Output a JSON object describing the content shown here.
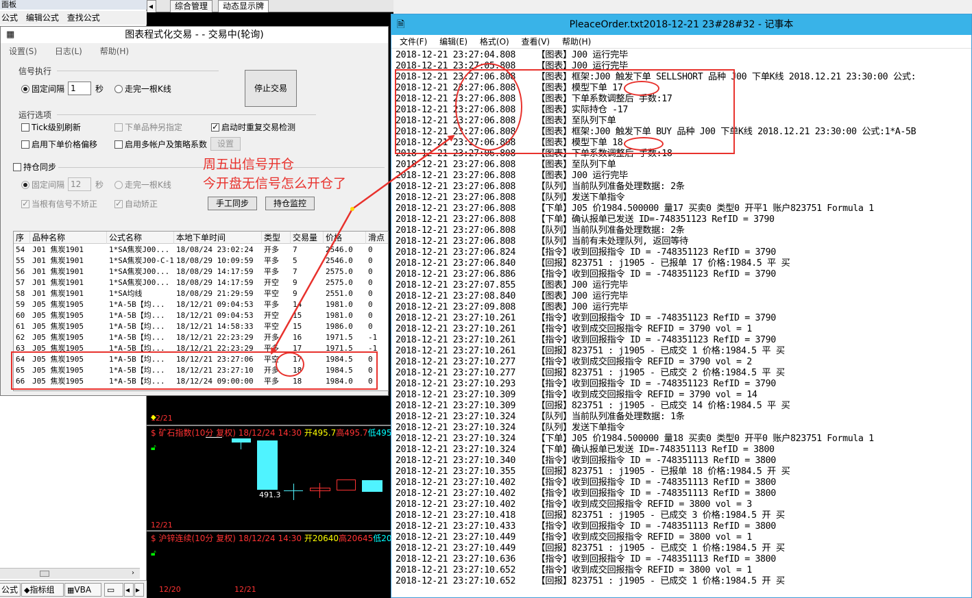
{
  "left_panel": {
    "title": "面板",
    "menu": [
      "公式",
      "编辑公式",
      "查找公式"
    ],
    "tabs": [
      "公式",
      "指标组",
      "VBA"
    ]
  },
  "chart": {
    "tabs": [
      "综合管理",
      "动态显示牌"
    ],
    "header1": {
      "icon": "$",
      "name": "矿石指数(10分 复权) 18/12/24 14:30",
      "open": "开495.7",
      "high": "高495.7",
      "low": "低495"
    },
    "price_label": "491.3",
    "date1": "12/21",
    "date_top": "12/21",
    "header2": {
      "icon": "$",
      "name": "沪锌连续(10分 复权) 18/12/24 14:30",
      "open": "开20640",
      "high": "高20645",
      "low": "低20"
    },
    "date2a": "12/20",
    "date2b": "12/21"
  },
  "dialog": {
    "title": "图表程式化交易 - - 交易中(轮询)",
    "menu": [
      "设置(S)",
      "日志(L)",
      "帮助(H)"
    ],
    "signal_group": "信号执行",
    "fixed_interval": "固定间隔",
    "interval_value": "1",
    "seconds": "秒",
    "walk_kline": "走完一根K线",
    "stop_button": "停止交易",
    "run_options": "运行选项",
    "tick_refresh": "Tick级别刷新",
    "other_symbol": "下单品种另指定",
    "restart_check": "启动时重复交易检测",
    "price_offset": "启用下单价格偏移",
    "multi_account": "启用多帐户及策略系数",
    "settings_button": "设置",
    "pos_sync": "持仓同步",
    "sync_interval": "固定间隔",
    "sync_value": "12",
    "sync_seconds": "秒",
    "sync_walk": "走完一根K线",
    "no_correct": "当根有信号不矫正",
    "auto_correct": "自动矫正",
    "manual_sync_button": "手工同步",
    "pos_monitor_button": "持仓监控",
    "table": {
      "headers": [
        "序",
        "品种名称",
        "公式名称",
        "本地下单时间",
        "类型",
        "交易量",
        "价格",
        "滑点"
      ],
      "rows": [
        [
          "54",
          "J01 焦炭1901",
          "1*SA焦炭J00...",
          "18/08/24 23:02:24",
          "开多",
          "7",
          "2546.0",
          "0"
        ],
        [
          "55",
          "J01 焦炭1901",
          "1*SA焦炭J00-C-1",
          "18/08/29 10:09:59",
          "平多",
          "5",
          "2546.0",
          "0"
        ],
        [
          "56",
          "J01 焦炭1901",
          "1*SA焦炭J00...",
          "18/08/29 14:17:59",
          "平多",
          "7",
          "2575.0",
          "0"
        ],
        [
          "57",
          "J01 焦炭1901",
          "1*SA焦炭J00...",
          "18/08/29 14:17:59",
          "开空",
          "9",
          "2575.0",
          "0"
        ],
        [
          "58",
          "J01 焦炭1901",
          "1*SA均线",
          "18/08/29 21:29:59",
          "平空",
          "9",
          "2551.0",
          "0"
        ],
        [
          "59",
          "J05 焦炭1905",
          "1*A-5B【均...",
          "18/12/21 09:04:53",
          "平多",
          "14",
          "1981.0",
          "0"
        ],
        [
          "60",
          "J05 焦炭1905",
          "1*A-5B【均...",
          "18/12/21 09:04:53",
          "开空",
          "15",
          "1981.0",
          "0"
        ],
        [
          "61",
          "J05 焦炭1905",
          "1*A-5B【均...",
          "18/12/21 14:58:33",
          "平空",
          "15",
          "1986.0",
          "0"
        ],
        [
          "62",
          "J05 焦炭1905",
          "1*A-5B【均...",
          "18/12/21 22:23:29",
          "开多",
          "16",
          "1971.5",
          "-1"
        ],
        [
          "63",
          "J05 焦炭1905",
          "1*A-5B【均...",
          "18/12/21 22:23:29",
          "平多",
          "17",
          "1971.5",
          "-1"
        ],
        [
          "64",
          "J05 焦炭1905",
          "1*A-5B【均...",
          "18/12/21 23:27:06",
          "平空",
          "17",
          "1984.5",
          "0"
        ],
        [
          "65",
          "J05 焦炭1905",
          "1*A-5B【均...",
          "18/12/21 23:27:10",
          "开多",
          "18",
          "1984.5",
          "0"
        ],
        [
          "66",
          "J05 焦炭1905",
          "1*A-5B【均...",
          "18/12/24 09:00:00",
          "平多",
          "18",
          "1984.0",
          "0"
        ]
      ]
    }
  },
  "annotation": {
    "line1": "周五出信号开仓",
    "line2": "今开盘无信号怎么开仓了"
  },
  "notepad": {
    "title": "PleaceOrder.txt2018-12-21 23#28#32 - 记事本",
    "menu": [
      "文件(F)",
      "编辑(E)",
      "格式(O)",
      "查看(V)",
      "帮助(H)"
    ],
    "lines": [
      "2018-12-21 23:27:04.808    【图表】J00 运行完毕",
      "2018-12-21 23:27:05.808    【图表】J00 运行完毕",
      "2018-12-21 23:27:06.808    【图表】框架:J00 触发下单 SELLSHORT 品种 J00 下单K线 2018.12.21 23:30:00 公式:",
      "2018-12-21 23:27:06.808    【图表】模型下单 17",
      "2018-12-21 23:27:06.808    【图表】下单系数调整后 手数:17",
      "2018-12-21 23:27:06.808    【图表】实际持仓 -17",
      "2018-12-21 23:27:06.808    【图表】至队列下单",
      "2018-12-21 23:27:06.808    【图表】框架:J00 触发下单 BUY 品种 J00 下单K线 2018.12.21 23:30:00 公式:1*A-5B",
      "2018-12-21 23:27:06.808    【图表】模型下单 18",
      "2018-12-21 23:27:06.808    【图表】下单系数调整后 手数:18",
      "2018-12-21 23:27:06.808    【图表】至队列下单",
      "2018-12-21 23:27:06.808    【图表】J00 运行完毕",
      "2018-12-21 23:27:06.808    【队列】当前队列准备处理数据: 2条",
      "2018-12-21 23:27:06.808    【队列】发送下单指令",
      "2018-12-21 23:27:06.808    【下单】J05 价1984.500000 量17 买卖0 类型0 开平1 账户823751 Formula 1",
      "2018-12-21 23:27:06.808    【下单】确认报单已发送 ID=-748351123 RefID = 3790",
      "2018-12-21 23:27:06.808    【队列】当前队列准备处理数据: 2条",
      "2018-12-21 23:27:06.808    【队列】当前有未处理队列, 返回等待",
      "2018-12-21 23:27:06.824    【指令】收到回报指令 ID = -748351123 RefID = 3790",
      "2018-12-21 23:27:06.840    【回报】823751 : j1905 - 已报单 17 价格:1984.5 平 买",
      "2018-12-21 23:27:06.886    【指令】收到回报指令 ID = -748351123 RefID = 3790",
      "2018-12-21 23:27:07.855    【图表】J00 运行完毕",
      "2018-12-21 23:27:08.840    【图表】J00 运行完毕",
      "2018-12-21 23:27:09.808    【图表】J00 运行完毕",
      "2018-12-21 23:27:10.261    【指令】收到回报指令 ID = -748351123 RefID = 3790",
      "2018-12-21 23:27:10.261    【指令】收到成交回报指令 REFID = 3790 vol = 1",
      "2018-12-21 23:27:10.261    【指令】收到回报指令 ID = -748351123 RefID = 3790",
      "2018-12-21 23:27:10.261    【回报】823751 : j1905 - 已成交 1 价格:1984.5 平 买",
      "2018-12-21 23:27:10.277    【指令】收到成交回报指令 REFID = 3790 vol = 2",
      "2018-12-21 23:27:10.277    【回报】823751 : j1905 - 已成交 2 价格:1984.5 平 买",
      "2018-12-21 23:27:10.293    【指令】收到回报指令 ID = -748351123 RefID = 3790",
      "2018-12-21 23:27:10.309    【指令】收到成交回报指令 REFID = 3790 vol = 14",
      "2018-12-21 23:27:10.309    【回报】823751 : j1905 - 已成交 14 价格:1984.5 平 买",
      "2018-12-21 23:27:10.324    【队列】当前队列准备处理数据: 1条",
      "2018-12-21 23:27:10.324    【队列】发送下单指令",
      "2018-12-21 23:27:10.324    【下单】J05 价1984.500000 量18 买卖0 类型0 开平0 账户823751 Formula 1",
      "2018-12-21 23:27:10.324    【下单】确认报单已发送 ID=-748351113 RefID = 3800",
      "2018-12-21 23:27:10.340    【指令】收到回报指令 ID = -748351113 RefID = 3800",
      "2018-12-21 23:27:10.355    【回报】823751 : j1905 - 已报单 18 价格:1984.5 开 买",
      "2018-12-21 23:27:10.402    【指令】收到回报指令 ID = -748351113 RefID = 3800",
      "2018-12-21 23:27:10.402    【指令】收到回报指令 ID = -748351113 RefID = 3800",
      "2018-12-21 23:27:10.402    【指令】收到成交回报指令 REFID = 3800 vol = 3",
      "2018-12-21 23:27:10.418    【回报】823751 : j1905 - 已成交 3 价格:1984.5 开 买",
      "2018-12-21 23:27:10.433    【指令】收到回报指令 ID = -748351113 RefID = 3800",
      "2018-12-21 23:27:10.449    【指令】收到成交回报指令 REFID = 3800 vol = 1",
      "2018-12-21 23:27:10.449    【回报】823751 : j1905 - 已成交 1 价格:1984.5 开 买",
      "2018-12-21 23:27:10.636    【指令】收到回报指令 ID = -748351113 RefID = 3800",
      "2018-12-21 23:27:10.652    【指令】收到成交回报指令 REFID = 3800 vol = 1",
      "2018-12-21 23:27:10.652    【回报】823751 : j1905 - 已成交 1 价格:1984.5 开 买"
    ]
  },
  "colors": {
    "annotation_red": "#e8312c",
    "notepad_titlebar": "#39b3e8",
    "candle_cyan": "#4ff3ff"
  }
}
